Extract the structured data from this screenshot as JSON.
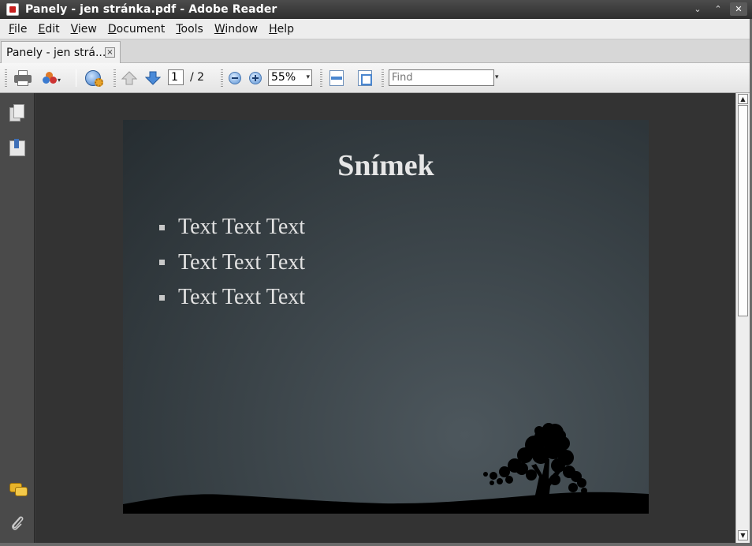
{
  "window": {
    "title": "Panely - jen stránka.pdf - Adobe Reader",
    "buttons": {
      "minimize": "⌄",
      "maximize": "⌃",
      "close": "✕"
    }
  },
  "menu": {
    "items": [
      {
        "key": "F",
        "rest": "ile"
      },
      {
        "key": "E",
        "rest": "dit"
      },
      {
        "key": "V",
        "rest": "iew"
      },
      {
        "key": "D",
        "rest": "ocument"
      },
      {
        "key": "T",
        "rest": "ools"
      },
      {
        "key": "W",
        "rest": "indow"
      },
      {
        "key": "H",
        "rest": "elp"
      }
    ]
  },
  "tab": {
    "label": "Panely - jen strá...",
    "close": "×"
  },
  "toolbar": {
    "current_page": "1",
    "page_total": "/ 2",
    "zoom": "55%",
    "find_placeholder": "Find"
  },
  "slide": {
    "title": "Snímek",
    "bullets": [
      "Text Text Text",
      "Text Text Text",
      "Text Text Text"
    ]
  },
  "colors": {
    "slide_text": "#e6e6e6",
    "doc_background": "#333333",
    "title_bar": "#3a3a3a"
  }
}
